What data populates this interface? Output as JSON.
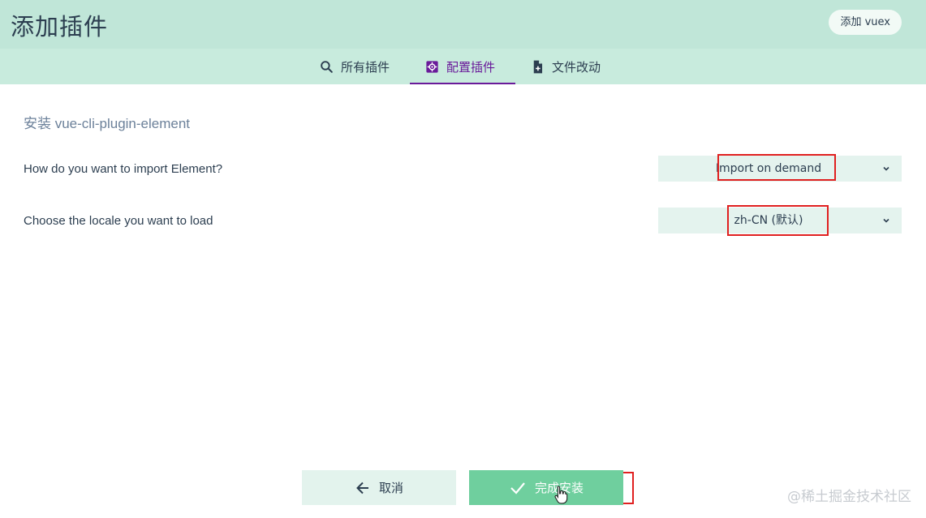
{
  "header": {
    "title": "添加插件",
    "action_button": "添加 vuex"
  },
  "tabs": [
    {
      "label": "所有插件",
      "icon": "search-icon",
      "active": false
    },
    {
      "label": "配置插件",
      "icon": "gear-icon",
      "active": true
    },
    {
      "label": "文件改动",
      "icon": "file-plus-icon",
      "active": false
    }
  ],
  "config": {
    "title": "安装 vue-cli-plugin-element",
    "prompts": [
      {
        "label": "How do you want to import Element?",
        "value": "Import on demand"
      },
      {
        "label": "Choose the locale you want to load",
        "value": "zh-CN (默认)"
      }
    ]
  },
  "footer": {
    "cancel_label": "取消",
    "finish_label": "完成安装"
  },
  "watermark": "@稀土掘金技术社区",
  "colors": {
    "header_bg": "#c0e6d8",
    "tab_active": "#6a1b9a",
    "finish_button": "#6fcf9e",
    "highlight": "#e02020"
  }
}
